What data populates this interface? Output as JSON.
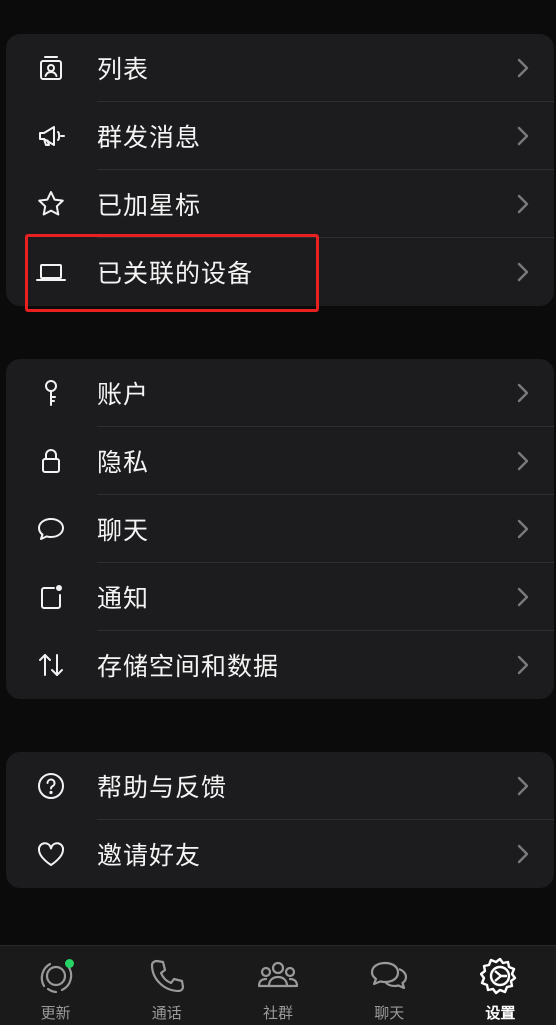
{
  "group1": [
    {
      "label": "列表",
      "icon": "contact-list-icon"
    },
    {
      "label": "群发消息",
      "icon": "megaphone-icon"
    },
    {
      "label": "已加星标",
      "icon": "star-icon"
    },
    {
      "label": "已关联的设备",
      "icon": "laptop-icon"
    }
  ],
  "group2": [
    {
      "label": "账户",
      "icon": "key-icon"
    },
    {
      "label": "隐私",
      "icon": "lock-icon"
    },
    {
      "label": "聊天",
      "icon": "chat-bubble-icon"
    },
    {
      "label": "通知",
      "icon": "notification-icon"
    },
    {
      "label": "存储空间和数据",
      "icon": "transfer-arrows-icon"
    }
  ],
  "group3": [
    {
      "label": "帮助与反馈",
      "icon": "help-icon"
    },
    {
      "label": "邀请好友",
      "icon": "heart-icon"
    }
  ],
  "tabs": [
    {
      "label": "更新",
      "icon": "updates-icon",
      "badge": true
    },
    {
      "label": "通话",
      "icon": "phone-icon"
    },
    {
      "label": "社群",
      "icon": "community-icon"
    },
    {
      "label": "聊天",
      "icon": "chats-icon"
    },
    {
      "label": "设置",
      "icon": "settings-gear-icon",
      "active": true
    }
  ],
  "colors": {
    "background": "#0b0b0b",
    "card": "#1c1c1e",
    "highlight_border": "#e8201f",
    "badge": "#25d366"
  }
}
